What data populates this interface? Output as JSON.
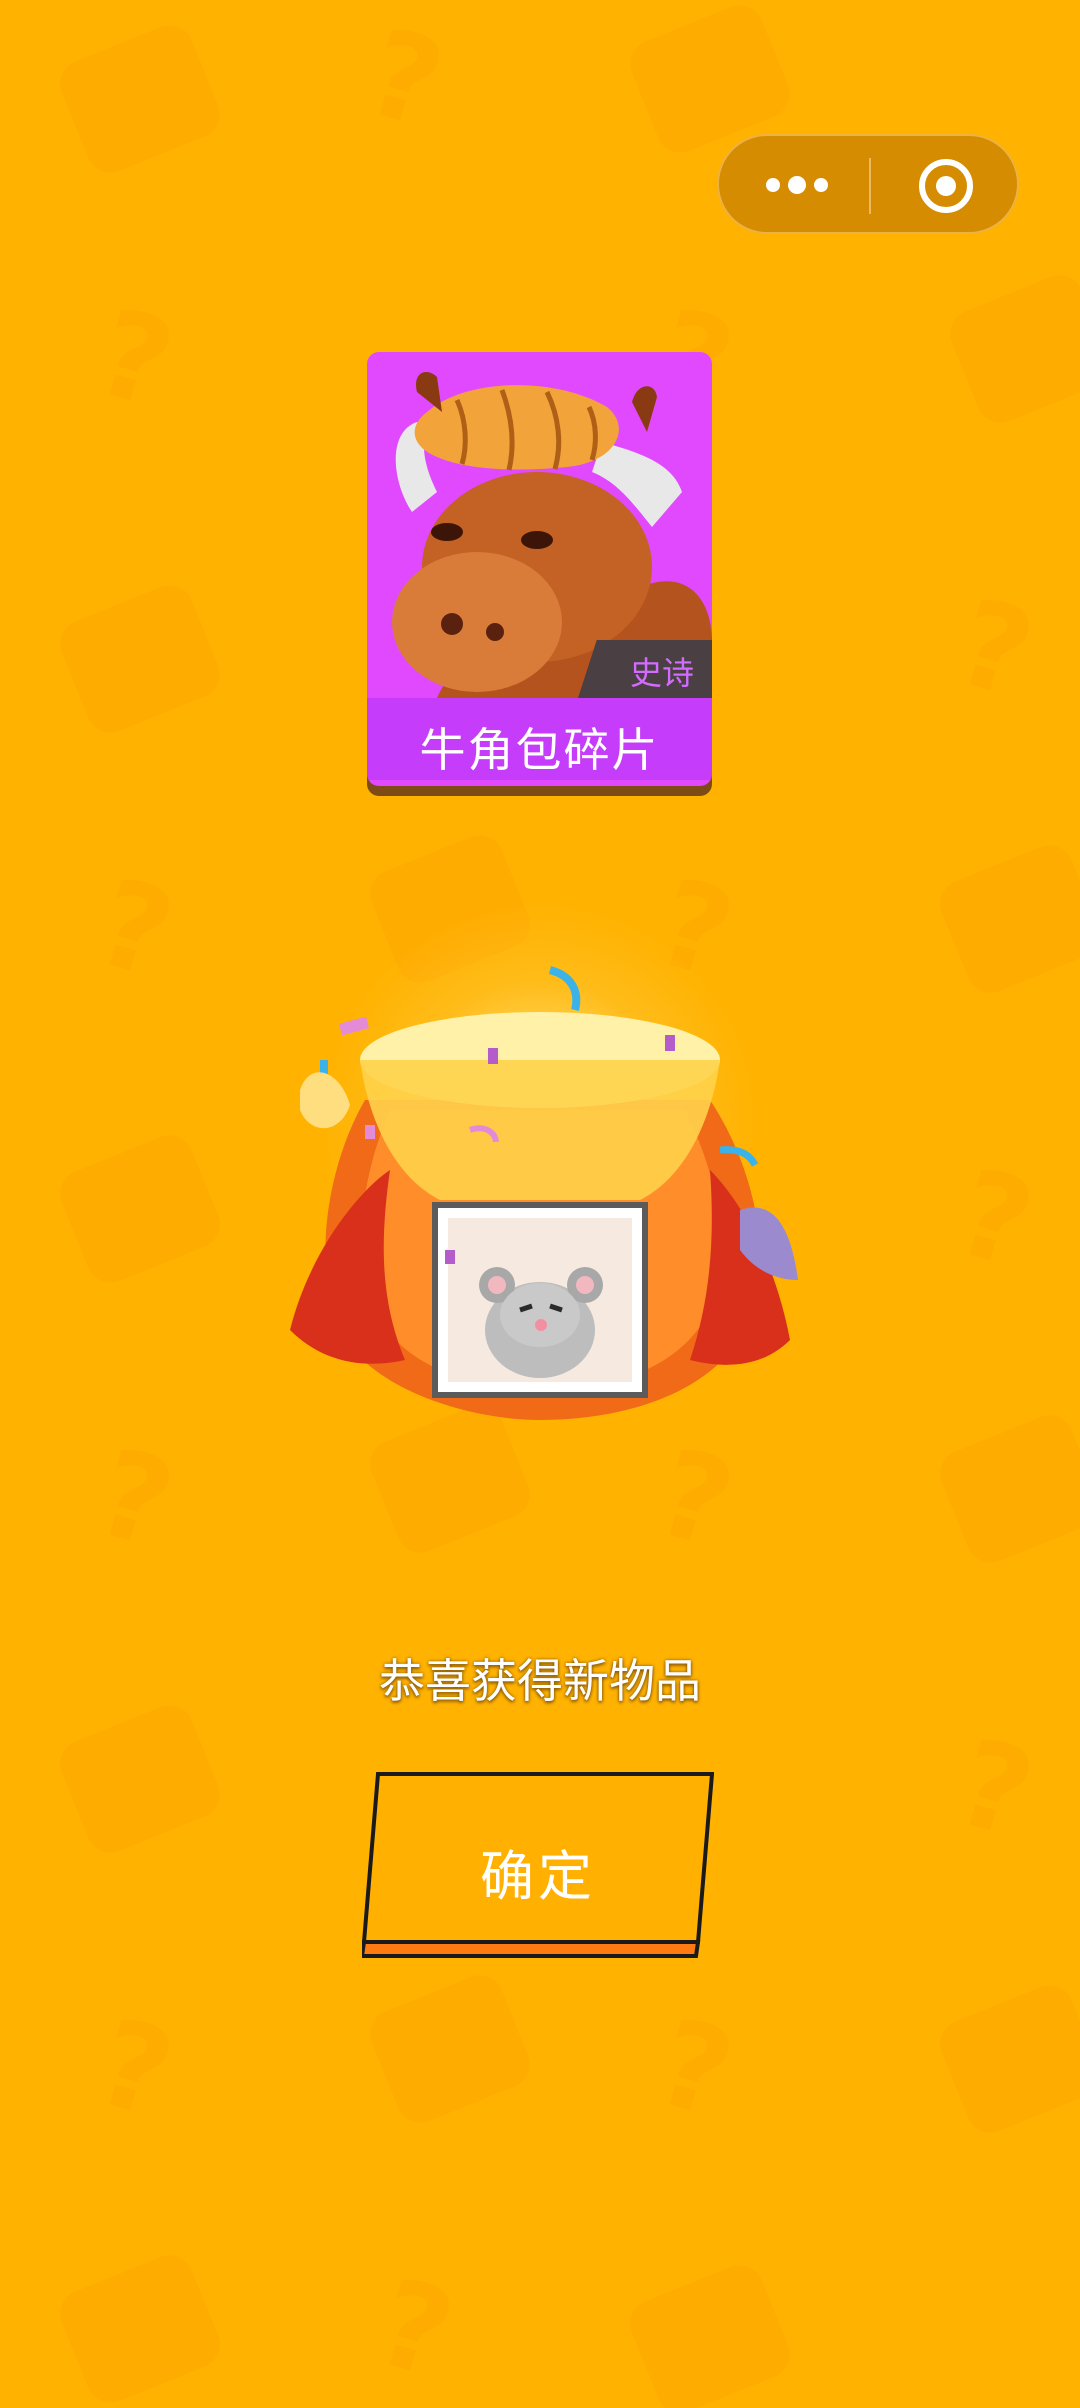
{
  "capsule": {
    "more_icon": "ellipsis-icon",
    "close_icon": "target-circle-icon"
  },
  "reward_card": {
    "rarity": "史诗",
    "name": "牛角包碎片",
    "card_color": "#E149FE",
    "name_bar_color": "#C53DFA"
  },
  "message": "恭喜获得新物品",
  "confirm_button": {
    "label": "确定"
  },
  "colors": {
    "background": "#FFB200",
    "button": "#FFB000",
    "button_border": "#1A1A1A"
  }
}
